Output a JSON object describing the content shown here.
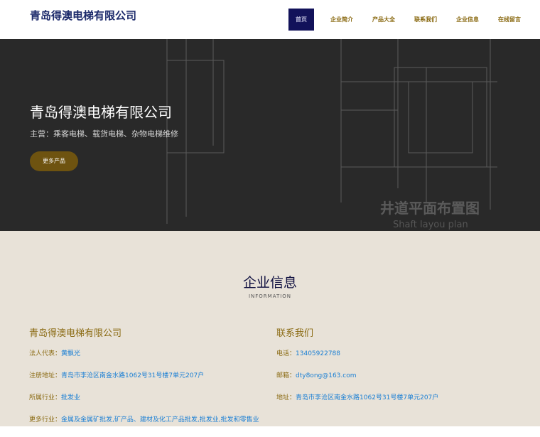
{
  "header": {
    "logo": "青岛得澳电梯有限公司",
    "nav": [
      "首页",
      "企业简介",
      "产品大全",
      "联系我们",
      "企业信息",
      "在线留言"
    ]
  },
  "hero": {
    "title": "青岛得澳电梯有限公司",
    "subtitle": "主营：乘客电梯、载货电梯、杂物电梯维修",
    "button": "更多产品",
    "bg_text_1": "井道平面布置图",
    "bg_text_2": "Shaft layou plan"
  },
  "info": {
    "title": "企业信息",
    "subtitle": "INFORMATION",
    "left": {
      "title": "青岛得澳电梯有限公司",
      "rows": [
        {
          "k": "法人代表：",
          "v": "黄飘光"
        },
        {
          "k": "注册地址：",
          "v": "青岛市李沧区南金水路1062号31号楼7单元207户"
        },
        {
          "k": "所属行业：",
          "v": "批发业"
        },
        {
          "k": "更多行业：",
          "v": "金属及金属矿批发,矿产品、建材及化工产品批发,批发业,批发和零售业"
        }
      ]
    },
    "right": {
      "title": "联系我们",
      "rows": [
        {
          "k": "电话：",
          "v": "13405922788"
        },
        {
          "k": "邮箱：",
          "v": "dty8ong@163.com"
        },
        {
          "k": "地址：",
          "v": "青岛市李沧区南金水路1062号31号楼7单元207户"
        }
      ]
    }
  }
}
